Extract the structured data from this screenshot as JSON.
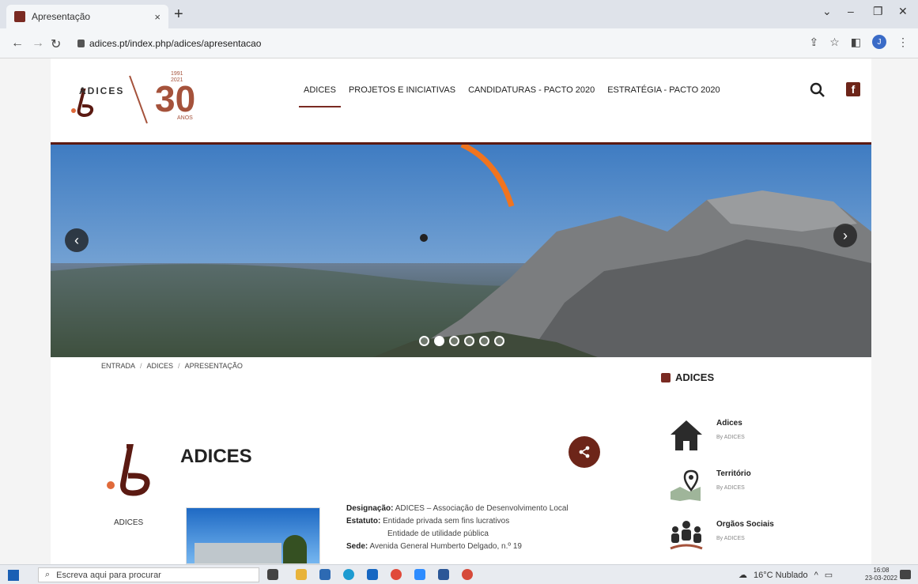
{
  "browser": {
    "tab_title": "Apresentação",
    "tab_close": "×",
    "new_tab": "+",
    "url": "adices.pt/index.php/adices/apresentacao",
    "profile_initial": "J"
  },
  "header": {
    "logo_text": "ADICES",
    "logo_years": "1991\n2021",
    "logo_30": "30",
    "logo_anos": "ANOS",
    "menu": [
      {
        "label": "ADICES",
        "active": true
      },
      {
        "label": "PROJETOS E INICIATIVAS",
        "active": false
      },
      {
        "label": "CANDIDATURAS - PACTO 2020",
        "active": false
      },
      {
        "label": "ESTRATÉGIA - PACTO 2020",
        "active": false
      }
    ]
  },
  "hero": {
    "dot_count": 6,
    "active_dot": 1
  },
  "breadcrumb": [
    "ENTRADA",
    "ADICES",
    "APRESENTAÇÃO"
  ],
  "breadcrumb_sep": "/",
  "main": {
    "title": "ADICES",
    "side_logo_label": "ADICES",
    "info": {
      "designacao_label": "Designação:",
      "designacao_value": "ADICES – Associação de Desenvolvimento Local",
      "estatuto_label": "Estatuto:",
      "estatuto_value_1": "Entidade privada sem fins lucrativos",
      "estatuto_value_2": "Entidade de utilidade pública",
      "sede_label": "Sede:",
      "sede_value": "Avenida General Humberto Delgado, n.º 19"
    }
  },
  "sidebar": {
    "title": "ADICES",
    "items": [
      {
        "name": "Adices",
        "by": "By ADICES"
      },
      {
        "name": "Território",
        "by": "By ADICES"
      },
      {
        "name": "Orgãos Sociais",
        "by": "By ADICES"
      }
    ]
  },
  "taskbar": {
    "search_placeholder": "Escreva aqui para procurar",
    "weather": "16°C Nublado",
    "time": "16:08",
    "date": "23-03-2022"
  },
  "colors": {
    "brand": "#6d2519",
    "accent": "#a5523b"
  }
}
